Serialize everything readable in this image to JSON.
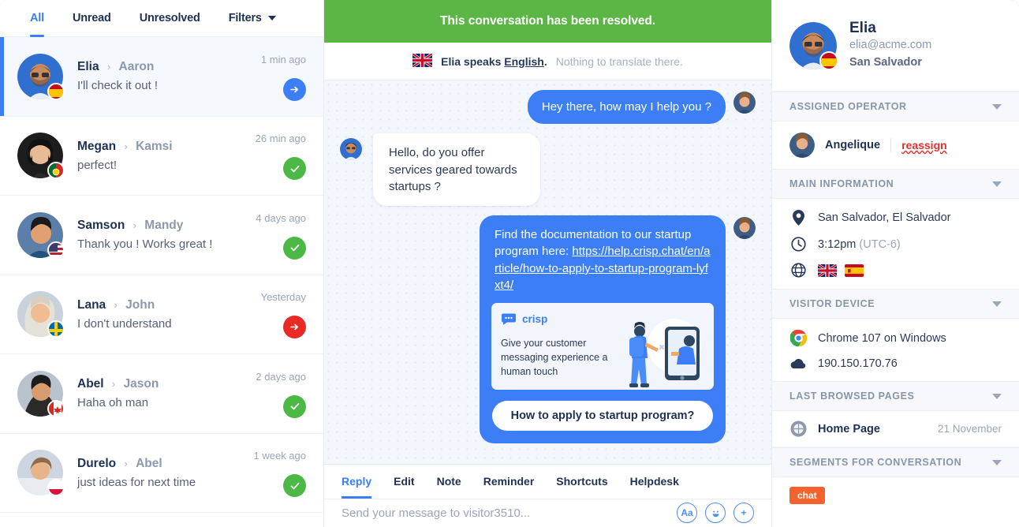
{
  "filters": {
    "tabs": [
      {
        "label": "All",
        "active": true
      },
      {
        "label": "Unread",
        "active": false
      },
      {
        "label": "Unresolved",
        "active": false
      }
    ],
    "dropdown_label": "Filters"
  },
  "conversations": [
    {
      "from": "Elia",
      "to": "Aaron",
      "separator": "›",
      "preview": "I'll check it out !",
      "time": "1 min ago",
      "status": "arrow",
      "status_color": "#3b7ef5",
      "flag": "es",
      "selected": true
    },
    {
      "from": "Megan",
      "to": "Kamsi",
      "separator": "›",
      "preview": "perfect!",
      "time": "26 min ago",
      "status": "check",
      "status_color": "#4cb946",
      "flag": "pt",
      "selected": false
    },
    {
      "from": "Samson",
      "to": "Mandy",
      "separator": "›",
      "preview": "Thank you ! Works great !",
      "time": "4 days ago",
      "status": "check",
      "status_color": "#4cb946",
      "flag": "us",
      "selected": false
    },
    {
      "from": "Lana",
      "to": "John",
      "separator": "›",
      "preview": "I don't understand",
      "time": "Yesterday",
      "status": "arrow",
      "status_color": "#ea2b25",
      "flag": "se",
      "selected": false
    },
    {
      "from": "Abel",
      "to": "Jason",
      "separator": "›",
      "preview": "Haha oh man",
      "time": "2 days ago",
      "status": "check",
      "status_color": "#4cb946",
      "flag": "ca",
      "selected": false
    },
    {
      "from": "Durelo",
      "to": "Abel",
      "separator": "›",
      "preview": "just ideas for next time",
      "time": "1 week ago",
      "status": "check",
      "status_color": "#4cb946",
      "flag": "pl",
      "selected": false
    }
  ],
  "conversation": {
    "resolved_banner": "This conversation has been resolved.",
    "translate": {
      "flag": "gb",
      "prefix": "Elia speaks ",
      "language": "English",
      "suffix": ".",
      "note": " Nothing to translate there."
    },
    "messages": [
      {
        "direction": "out",
        "text": "Hey there, how may I help you ?"
      },
      {
        "direction": "in",
        "text": "Hello, do you offer services geared towards startups ?"
      },
      {
        "direction": "out",
        "kind": "card",
        "text_before": "Find the documentation to our startup program here: ",
        "link": "https://help.crisp.chat/en/article/how-to-apply-to-startup-program-lyfxt4/",
        "card": {
          "brand": "crisp",
          "headline": "Give your customer messaging experience a human touch"
        },
        "cta": "How to apply to startup program?"
      }
    ],
    "reply_tabs": [
      {
        "label": "Reply",
        "active": true
      },
      {
        "label": "Edit",
        "active": false
      },
      {
        "label": "Note",
        "active": false
      },
      {
        "label": "Reminder",
        "active": false
      },
      {
        "label": "Shortcuts",
        "active": false
      },
      {
        "label": "Helpdesk",
        "active": false
      }
    ],
    "composer": {
      "placeholder": "Send your message to visitor3510...",
      "icons": [
        "text-format-icon",
        "emoji-icon",
        "attachment-icon"
      ]
    }
  },
  "panel": {
    "profile": {
      "name": "Elia",
      "email": "elia@acme.com",
      "location": "San Salvador",
      "flag": "es"
    },
    "assigned_operator": {
      "title": "ASSIGNED OPERATOR",
      "name": "Angelique",
      "action": "reassign"
    },
    "main_information": {
      "title": "MAIN INFORMATION",
      "location": "San Salvador, El Salvador",
      "time": "3:12pm",
      "timezone": "(UTC-6)",
      "languages": [
        "gb",
        "es"
      ]
    },
    "visitor_device": {
      "title": "VISITOR DEVICE",
      "browser": "Chrome 107 on Windows",
      "ip": "190.150.170.76"
    },
    "last_browsed_pages": {
      "title": "LAST BROWSED PAGES",
      "pages": [
        {
          "name": "Home Page",
          "date": "21 November"
        }
      ]
    },
    "segments": {
      "title": "SEGMENTS FOR CONVERSATION",
      "tags": [
        "chat"
      ]
    }
  },
  "colors": {
    "accent_blue": "#3b7ef5",
    "resolved_green": "#5cb645",
    "status_green": "#4cb946",
    "status_red": "#ea2b25",
    "danger_red": "#e0322c",
    "segment_orange": "#f4622d"
  }
}
